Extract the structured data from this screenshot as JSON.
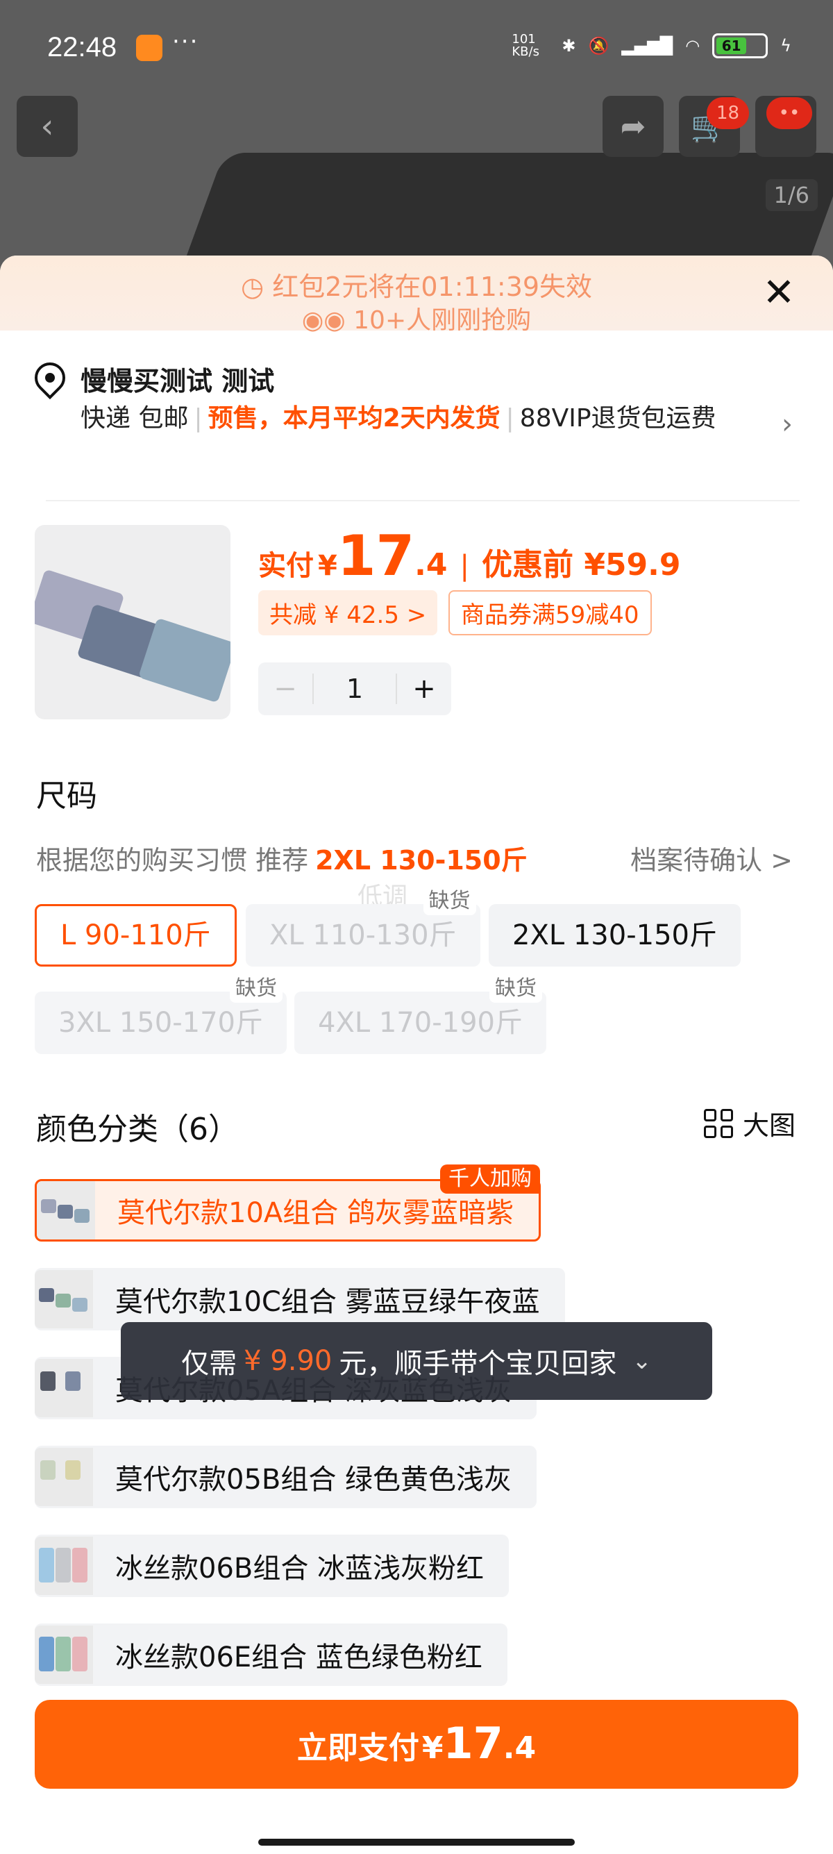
{
  "status_bar": {
    "time": "22:48",
    "dots": "···",
    "net_speed": "101 KB/s",
    "battery": "61"
  },
  "top_nav": {
    "cart_count": "18",
    "image_index": "1/6"
  },
  "promo": {
    "countdown_text": "红包2元将在01:11:39失效",
    "crowd_text": "10+人刚刚抢购"
  },
  "address": {
    "name": "慢慢买测试 测试",
    "shipping": "快递 包邮",
    "delivery": "预售，本月平均2天内发货",
    "service": "88VIP退货包运费"
  },
  "product": {
    "pay_label": "实付",
    "currency": "¥",
    "price_int": "17",
    "price_dec": ".4",
    "before_label": "优惠前 ¥59.9",
    "discount_tag": "共减 ¥ 42.5 >",
    "coupon_tag": "商品券满59减40",
    "quantity": "1",
    "minus": "−",
    "plus": "+"
  },
  "size": {
    "title": "尺码",
    "recommend_prefix": "根据您的购买习惯 推荐",
    "recommend_value": "2XL 130-150斤",
    "profile_link": "档案待确认 >",
    "watermark": "低调",
    "options": [
      {
        "label": "L 90-110斤",
        "state": "selected",
        "stock": ""
      },
      {
        "label": "XL 110-130斤",
        "state": "disabled",
        "stock": "缺货"
      },
      {
        "label": "2XL 130-150斤",
        "state": "normal",
        "stock": ""
      },
      {
        "label": "3XL 150-170斤",
        "state": "disabled",
        "stock": "缺货"
      },
      {
        "label": "4XL 170-190斤",
        "state": "disabled",
        "stock": "缺货"
      }
    ]
  },
  "color": {
    "title": "颜色分类（6）",
    "big_view": "大图",
    "hot_badge": "千人加购",
    "options": [
      {
        "label": "莫代尔款10A组合 鸽灰雾蓝暗紫",
        "state": "selected"
      },
      {
        "label": "莫代尔款10C组合 雾蓝豆绿午夜蓝",
        "state": "normal"
      },
      {
        "label": "莫代尔款05A组合 深灰蓝色浅灰",
        "state": "normal"
      },
      {
        "label": "莫代尔款05B组合 绿色黄色浅灰",
        "state": "normal"
      },
      {
        "label": "冰丝款06B组合 冰蓝浅灰粉红",
        "state": "normal"
      },
      {
        "label": "冰丝款06E组合 蓝色绿色粉红",
        "state": "normal"
      }
    ]
  },
  "toast": {
    "prefix": "仅需",
    "price": "¥ 9.90",
    "suffix": "元，顺手带个宝贝回家"
  },
  "pay_button": {
    "label": "立即支付",
    "currency": "¥",
    "price_int": "17",
    "price_dec": ".4"
  },
  "colors": {
    "accent": "#ff5000",
    "button": "#ff6308",
    "promo_text": "#f5956a"
  }
}
